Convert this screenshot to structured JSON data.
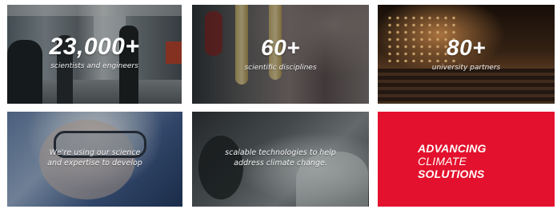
{
  "tiles": [
    {
      "stat": "23,000+",
      "caption": "scientists and engineers"
    },
    {
      "stat": "60+",
      "caption": "scientific disciplines"
    },
    {
      "stat": "80+",
      "caption": "university partners"
    },
    {
      "message": [
        "We're using our science",
        "and expertise to develop"
      ]
    },
    {
      "message": [
        "scalable technologies to help",
        "address climate change."
      ]
    },
    {
      "slogan": [
        "ADVANCING",
        "CLIMATE",
        "SOLUTIONS"
      ]
    }
  ],
  "colors": {
    "brand_red": "#e3112d",
    "text": "#ffffff"
  }
}
